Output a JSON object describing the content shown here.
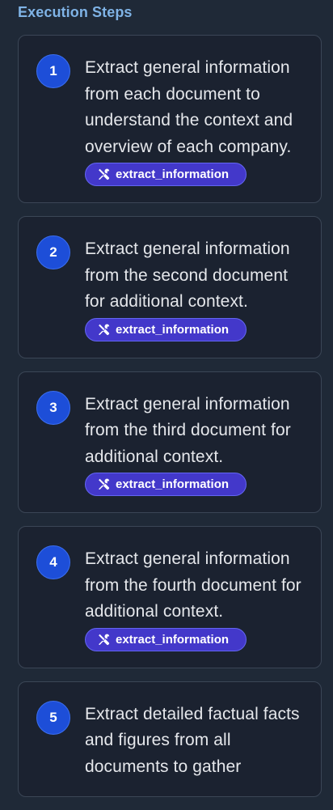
{
  "section": {
    "title": "Execution Steps"
  },
  "steps": [
    {
      "number": "1",
      "text": "Extract general information from each document to understand the context and overview of each company.",
      "tool": "extract_information"
    },
    {
      "number": "2",
      "text": "Extract general information from the second document for additional context.",
      "tool": "extract_information"
    },
    {
      "number": "3",
      "text": "Extract general information from the third document for additional context.",
      "tool": "extract_information"
    },
    {
      "number": "4",
      "text": "Extract general information from the fourth document for additional context.",
      "tool": "extract_information"
    },
    {
      "number": "5",
      "text": "Extract detailed factual facts and figures from all documents to gather",
      "tool": ""
    }
  ],
  "icons": {
    "tool_icon": "tools-icon"
  },
  "colors": {
    "background": "#1f2937",
    "card": "#1b2230",
    "title": "#7fb3e6",
    "step_circle": "#1d4ed8",
    "badge": "#4338ca"
  }
}
